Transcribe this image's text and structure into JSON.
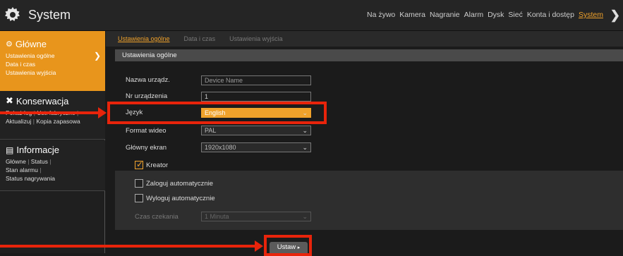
{
  "app": {
    "title": "System"
  },
  "topnav": {
    "items": [
      "Na żywo",
      "Kamera",
      "Nagranie",
      "Alarm",
      "Dysk",
      "Sieć",
      "Konta i dostęp",
      "System"
    ],
    "active_index": 7
  },
  "sidebar": {
    "main": {
      "title": "Główne",
      "links": [
        "Ustawienia ogólne",
        "Data i czas",
        "Ustawienia wyjścia"
      ]
    },
    "maintenance": {
      "title": "Konserwacja",
      "row1": [
        "Pokaż log",
        "Ust. fabryczne"
      ],
      "row2": [
        "Aktualizuj",
        "Kopia zapasowa"
      ]
    },
    "info": {
      "title": "Informacje",
      "row1": [
        "Główne",
        "Status"
      ],
      "row2": [
        "Stan alarmu"
      ],
      "row3": [
        "Status nagrywania"
      ]
    }
  },
  "subtabs": [
    "Ustawienia ogólne",
    "Data i czas",
    "Ustawienia wyjścia"
  ],
  "panel": {
    "header": "Ustawienia ogólne",
    "device_name": {
      "label": "Nazwa urządz.",
      "value": "Device Name"
    },
    "device_no": {
      "label": "Nr urządzenia",
      "value": "1"
    },
    "language": {
      "label": "Język",
      "value": "English"
    },
    "video_format": {
      "label": "Format wideo",
      "value": "PAL"
    },
    "main_screen": {
      "label": "Główny ekran",
      "value": "1920x1080"
    },
    "wizard": {
      "label": "Kreator",
      "checked": true
    },
    "auto_login": {
      "label": "Zaloguj automatycznie",
      "checked": false
    },
    "auto_logout": {
      "label": "Wyloguj automatycznie",
      "checked": false
    },
    "wait_time": {
      "label": "Czas czekania",
      "value": "1 Minuta"
    },
    "apply_button": "Ustaw"
  },
  "colors": {
    "accent": "#f0a22b",
    "highlight": "#e8240b",
    "sidebar_active": "#e8951c"
  }
}
